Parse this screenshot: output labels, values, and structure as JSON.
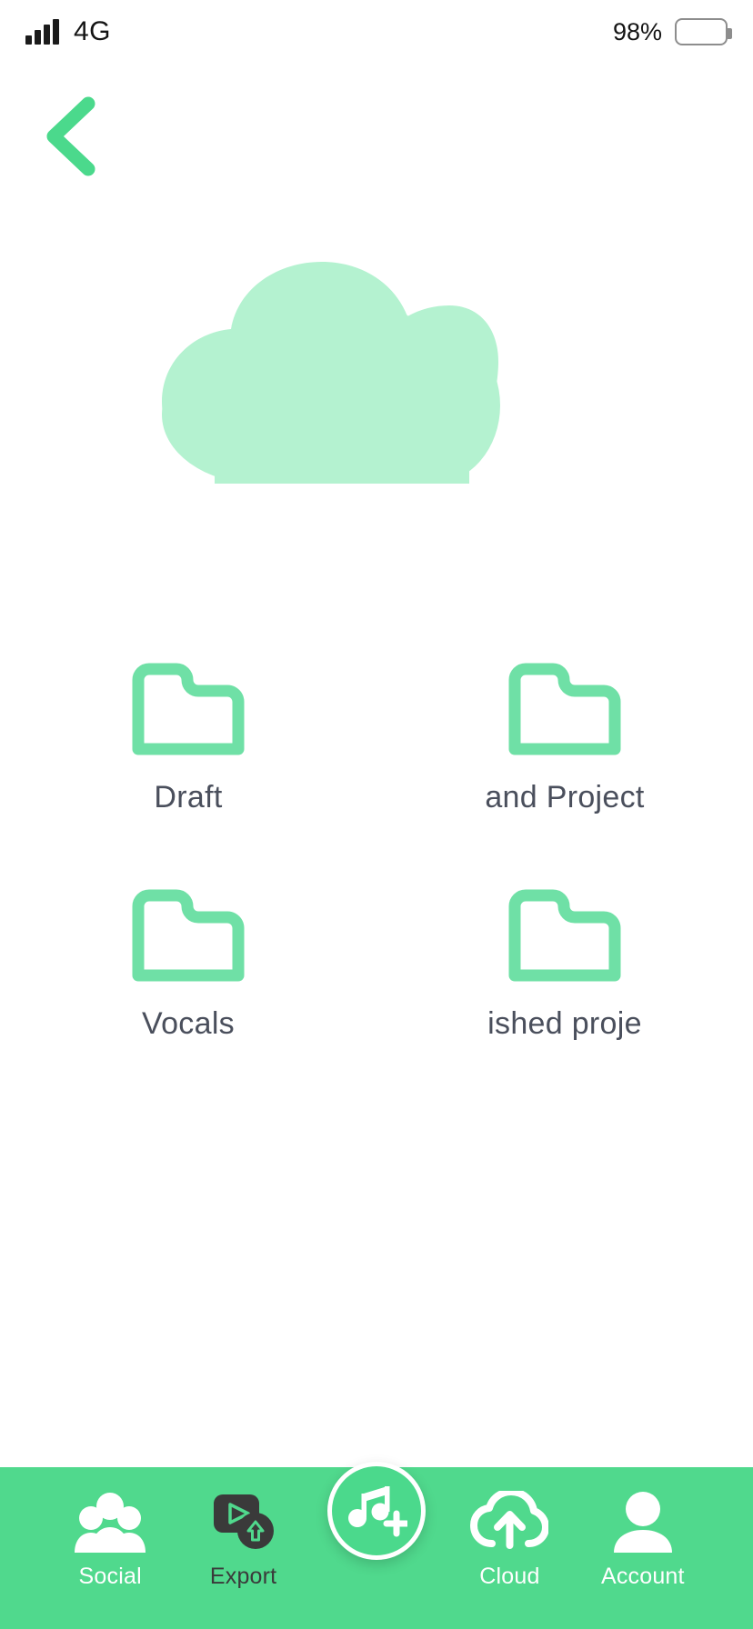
{
  "status_bar": {
    "network": "4G",
    "battery_percent": "98%",
    "signal_icon": "signal-bars-icon",
    "battery_icon": "battery-icon"
  },
  "header": {
    "back_icon": "chevron-left-icon"
  },
  "hero": {
    "icon": "cloud-icon",
    "fill_color": "#B4F2D0"
  },
  "folders": {
    "accent_color": "#6FE0A6",
    "label_color": "#4a4f5c",
    "items": [
      {
        "label": "Draft",
        "icon": "folder-icon",
        "clipped": false
      },
      {
        "label": "and Project",
        "icon": "folder-icon",
        "clipped": true
      },
      {
        "label": "Vocals",
        "icon": "folder-icon",
        "clipped": false
      },
      {
        "label": "ished proje",
        "icon": "folder-icon",
        "clipped": true
      }
    ]
  },
  "bottom_nav": {
    "background_color": "#50D98D",
    "fab": {
      "icon": "music-note-plus-icon",
      "background_color": "#4BD98C",
      "ring_color": "#FFFFFF"
    },
    "items": [
      {
        "label": "Social",
        "icon": "people-group-icon",
        "style": "light"
      },
      {
        "label": "Export",
        "icon": "video-export-icon",
        "style": "dark"
      },
      {
        "label": "Cloud",
        "icon": "cloud-upload-icon",
        "style": "light"
      },
      {
        "label": "Account",
        "icon": "user-person-icon",
        "style": "light"
      }
    ]
  }
}
